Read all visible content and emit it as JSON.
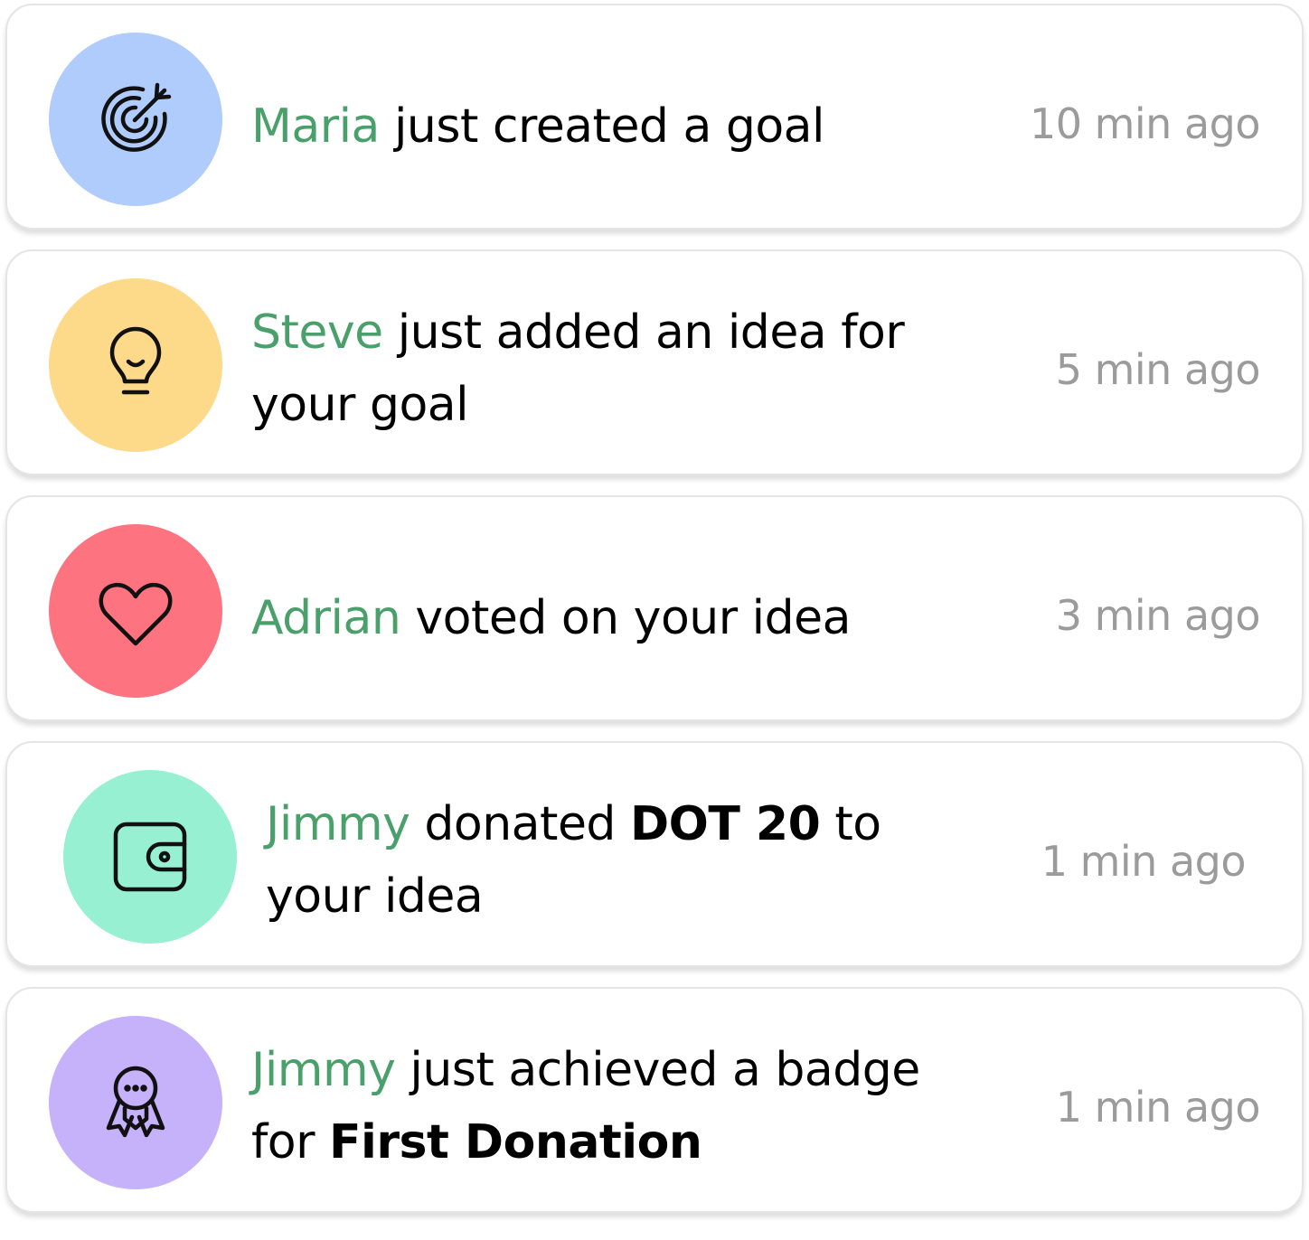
{
  "colors": {
    "name_green": "#49a06a",
    "time_gray": "#9b9b9b",
    "goal_circle": "#b0ccfc",
    "idea_circle": "#fdd98a",
    "vote_circle": "#fd7380",
    "donate_circle": "#97f0d2",
    "badge_circle": "#c6b1fb"
  },
  "notifications": [
    {
      "icon": "target-icon",
      "name": "Maria",
      "text": "just created a goal",
      "time": "10 min ago"
    },
    {
      "icon": "lightbulb-icon",
      "name": "Steve",
      "text": "just added an idea for your goal",
      "time": "5 min ago"
    },
    {
      "icon": "heart-icon",
      "name": "Adrian",
      "text": "voted on your idea",
      "time": "3 min ago"
    },
    {
      "icon": "wallet-icon",
      "name": "Jimmy",
      "text_before": "donated",
      "amount": "DOT 20",
      "text_after": "to your idea",
      "time": "1 min ago"
    },
    {
      "icon": "badge-icon",
      "name": "Jimmy",
      "text_before": "just achieved a badge for",
      "badge": "First Donation",
      "time": "1 min ago"
    }
  ]
}
